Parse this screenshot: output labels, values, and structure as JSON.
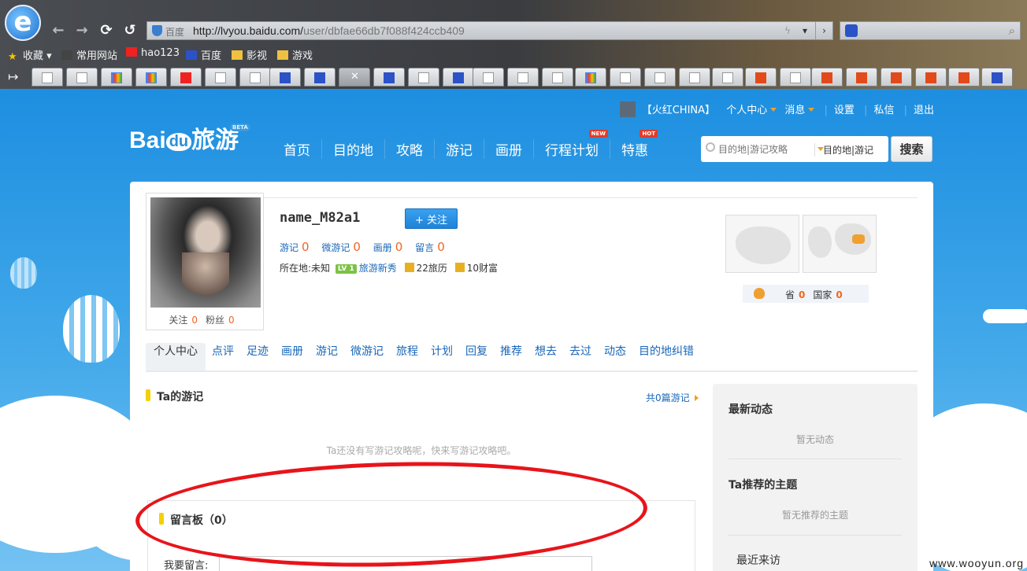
{
  "browser": {
    "address_site": "百度",
    "url_host": "http://lvyou.baidu.com/",
    "url_path": "user/dbfae66db7f088f424ccb409",
    "favorites": [
      "收藏",
      "常用网站",
      "hao123",
      "百度",
      "影视",
      "游戏"
    ]
  },
  "topnav": {
    "nickname": "【火红CHINA】",
    "center": "个人中心",
    "message": "消息",
    "settings": "设置",
    "pm": "私信",
    "logout": "退出"
  },
  "logo": {
    "bai": "Bai",
    "du": "du",
    "lvyou": "旅游",
    "beta": "BETA"
  },
  "mainnav": {
    "items": [
      "首页",
      "目的地",
      "攻略",
      "游记",
      "画册",
      "行程计划",
      "特惠"
    ],
    "badge_new": "NEW",
    "badge_hot": "HOT"
  },
  "search": {
    "placeholder": "目的地|游记攻略",
    "scope": "目的地|游记",
    "button": "搜索"
  },
  "profile": {
    "username": "name_M82a1",
    "follow_btn": "+ 关注",
    "following_label": "关注",
    "following": "0",
    "fans_label": "粉丝",
    "fans": "0",
    "stats": [
      {
        "label": "游记",
        "value": "0"
      },
      {
        "label": "微游记",
        "value": "0"
      },
      {
        "label": "画册",
        "value": "0"
      },
      {
        "label": "留言",
        "value": "0"
      }
    ],
    "location_label": "所在地:",
    "location": "未知",
    "level": "LV 1",
    "title": "旅游新秀",
    "travel_exp": "22旅历",
    "wealth": "10财富",
    "province_label": "省",
    "province": "0",
    "country_label": "国家",
    "country": "0"
  },
  "tabs": [
    "个人中心",
    "点评",
    "足迹",
    "画册",
    "游记",
    "微游记",
    "旅程",
    "计划",
    "回复",
    "推荐",
    "想去",
    "去过",
    "动态",
    "目的地纠错"
  ],
  "travelnotes": {
    "title": "Ta的游记",
    "more": "共0篇游记",
    "empty": "Ta还没有写游记攻略呢，快来写游记攻略吧。"
  },
  "messageboard": {
    "title": "留言板（0）",
    "input_label": "我要留言:"
  },
  "sidebar": {
    "latest_title": "最新动态",
    "latest_empty": "暂无动态",
    "rec_title": "Ta推荐的主题",
    "rec_empty": "暂无推荐的主题",
    "recent_visit": "最近来访"
  },
  "watermark": "www.wooyun.org"
}
